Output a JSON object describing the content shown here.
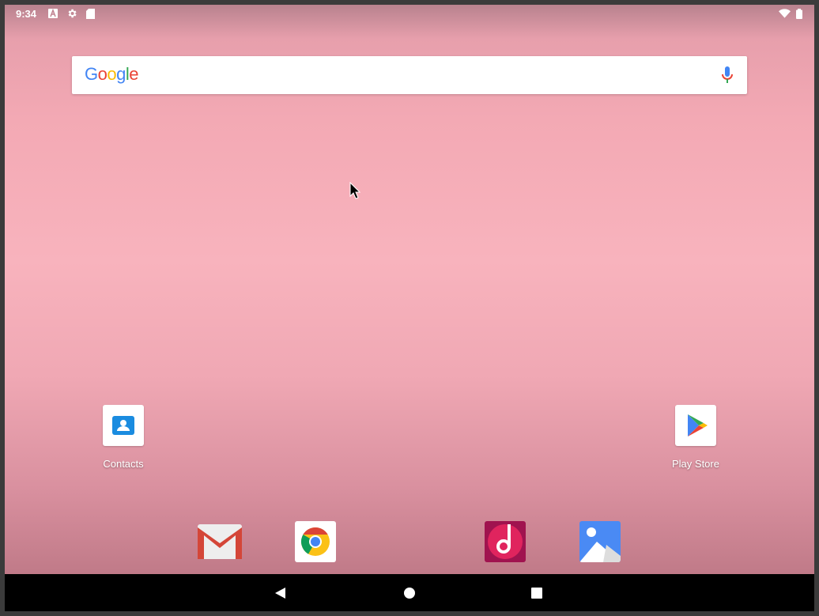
{
  "status_bar": {
    "time": "9:34",
    "icons": [
      "keyboard-a-icon",
      "gear-icon",
      "sd-card-icon"
    ],
    "right_icons": [
      "wifi-icon",
      "battery-icon"
    ]
  },
  "search": {
    "logo": "Google",
    "icon": "mic-icon"
  },
  "apps": [
    {
      "label": "Contacts",
      "icon": "contacts-icon"
    },
    {
      "label": "Play Store",
      "icon": "play-store-icon"
    }
  ],
  "dock": [
    {
      "name": "Gmail",
      "icon": "gmail-icon"
    },
    {
      "name": "Chrome",
      "icon": "chrome-icon"
    },
    {
      "name": "Music",
      "icon": "music-icon"
    },
    {
      "name": "Gallery",
      "icon": "gallery-icon"
    }
  ],
  "nav": {
    "buttons": [
      "back",
      "home",
      "recents"
    ]
  },
  "colors": {
    "wallpaper": "#f8b3bd",
    "nav_bar": "#000000"
  }
}
